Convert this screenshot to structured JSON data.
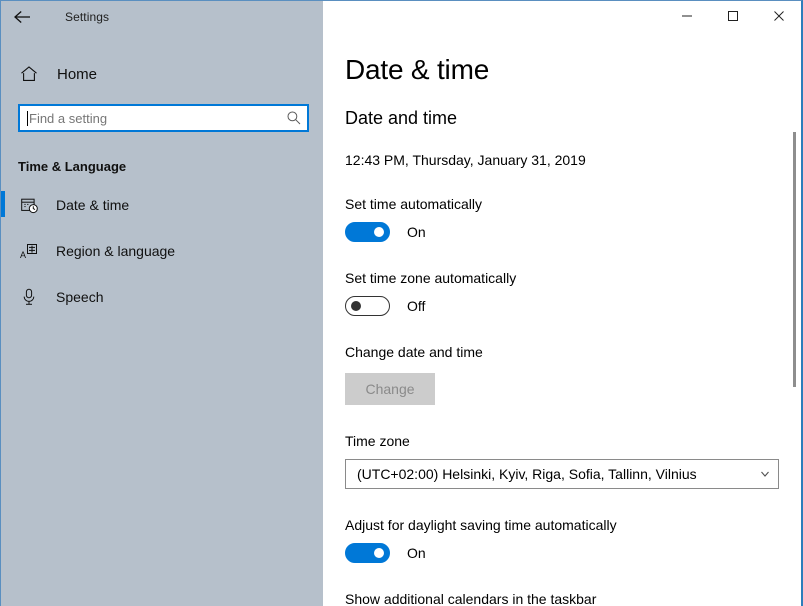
{
  "window": {
    "app_title": "Settings",
    "back_icon": "back-arrow-icon",
    "caption": {
      "minimize_label": "Minimize",
      "maximize_label": "Maximize",
      "close_label": "Close"
    }
  },
  "sidebar": {
    "home": {
      "label": "Home",
      "icon": "home-icon"
    },
    "search": {
      "value": "",
      "placeholder": "Find a setting",
      "icon": "search-icon"
    },
    "section_title": "Time & Language",
    "items": [
      {
        "label": "Date & time",
        "icon": "calendar-clock-icon",
        "glyph": "☷",
        "selected": true
      },
      {
        "label": "Region & language",
        "icon": "language-icon",
        "glyph": "A",
        "selected": false
      },
      {
        "label": "Speech",
        "icon": "microphone-icon",
        "glyph": "⏺",
        "selected": false
      }
    ]
  },
  "main": {
    "page_title": "Date & time",
    "group_header": "Date and time",
    "current_datetime": "12:43 PM, Thursday, January 31, 2019",
    "settings": {
      "set_time_auto": {
        "label": "Set time automatically",
        "state": "On",
        "on": true
      },
      "set_timezone_auto": {
        "label": "Set time zone automatically",
        "state": "Off",
        "on": false
      },
      "change_date_time": {
        "label": "Change date and time",
        "button_label": "Change",
        "disabled": true
      },
      "time_zone": {
        "label": "Time zone",
        "value": "(UTC+02:00) Helsinki, Kyiv, Riga, Sofia, Tallinn, Vilnius",
        "chevron_icon": "chevron-down-icon"
      },
      "daylight_saving": {
        "label": "Adjust for daylight saving time automatically",
        "state": "On",
        "on": true
      },
      "additional_calendars": {
        "label": "Show additional calendars in the taskbar"
      }
    }
  },
  "colors": {
    "accent": "#0078d7",
    "sidebar_bg": "#b6c0cb",
    "window_border": "#2d7dbb",
    "disabled_button_bg": "#cccccc"
  }
}
